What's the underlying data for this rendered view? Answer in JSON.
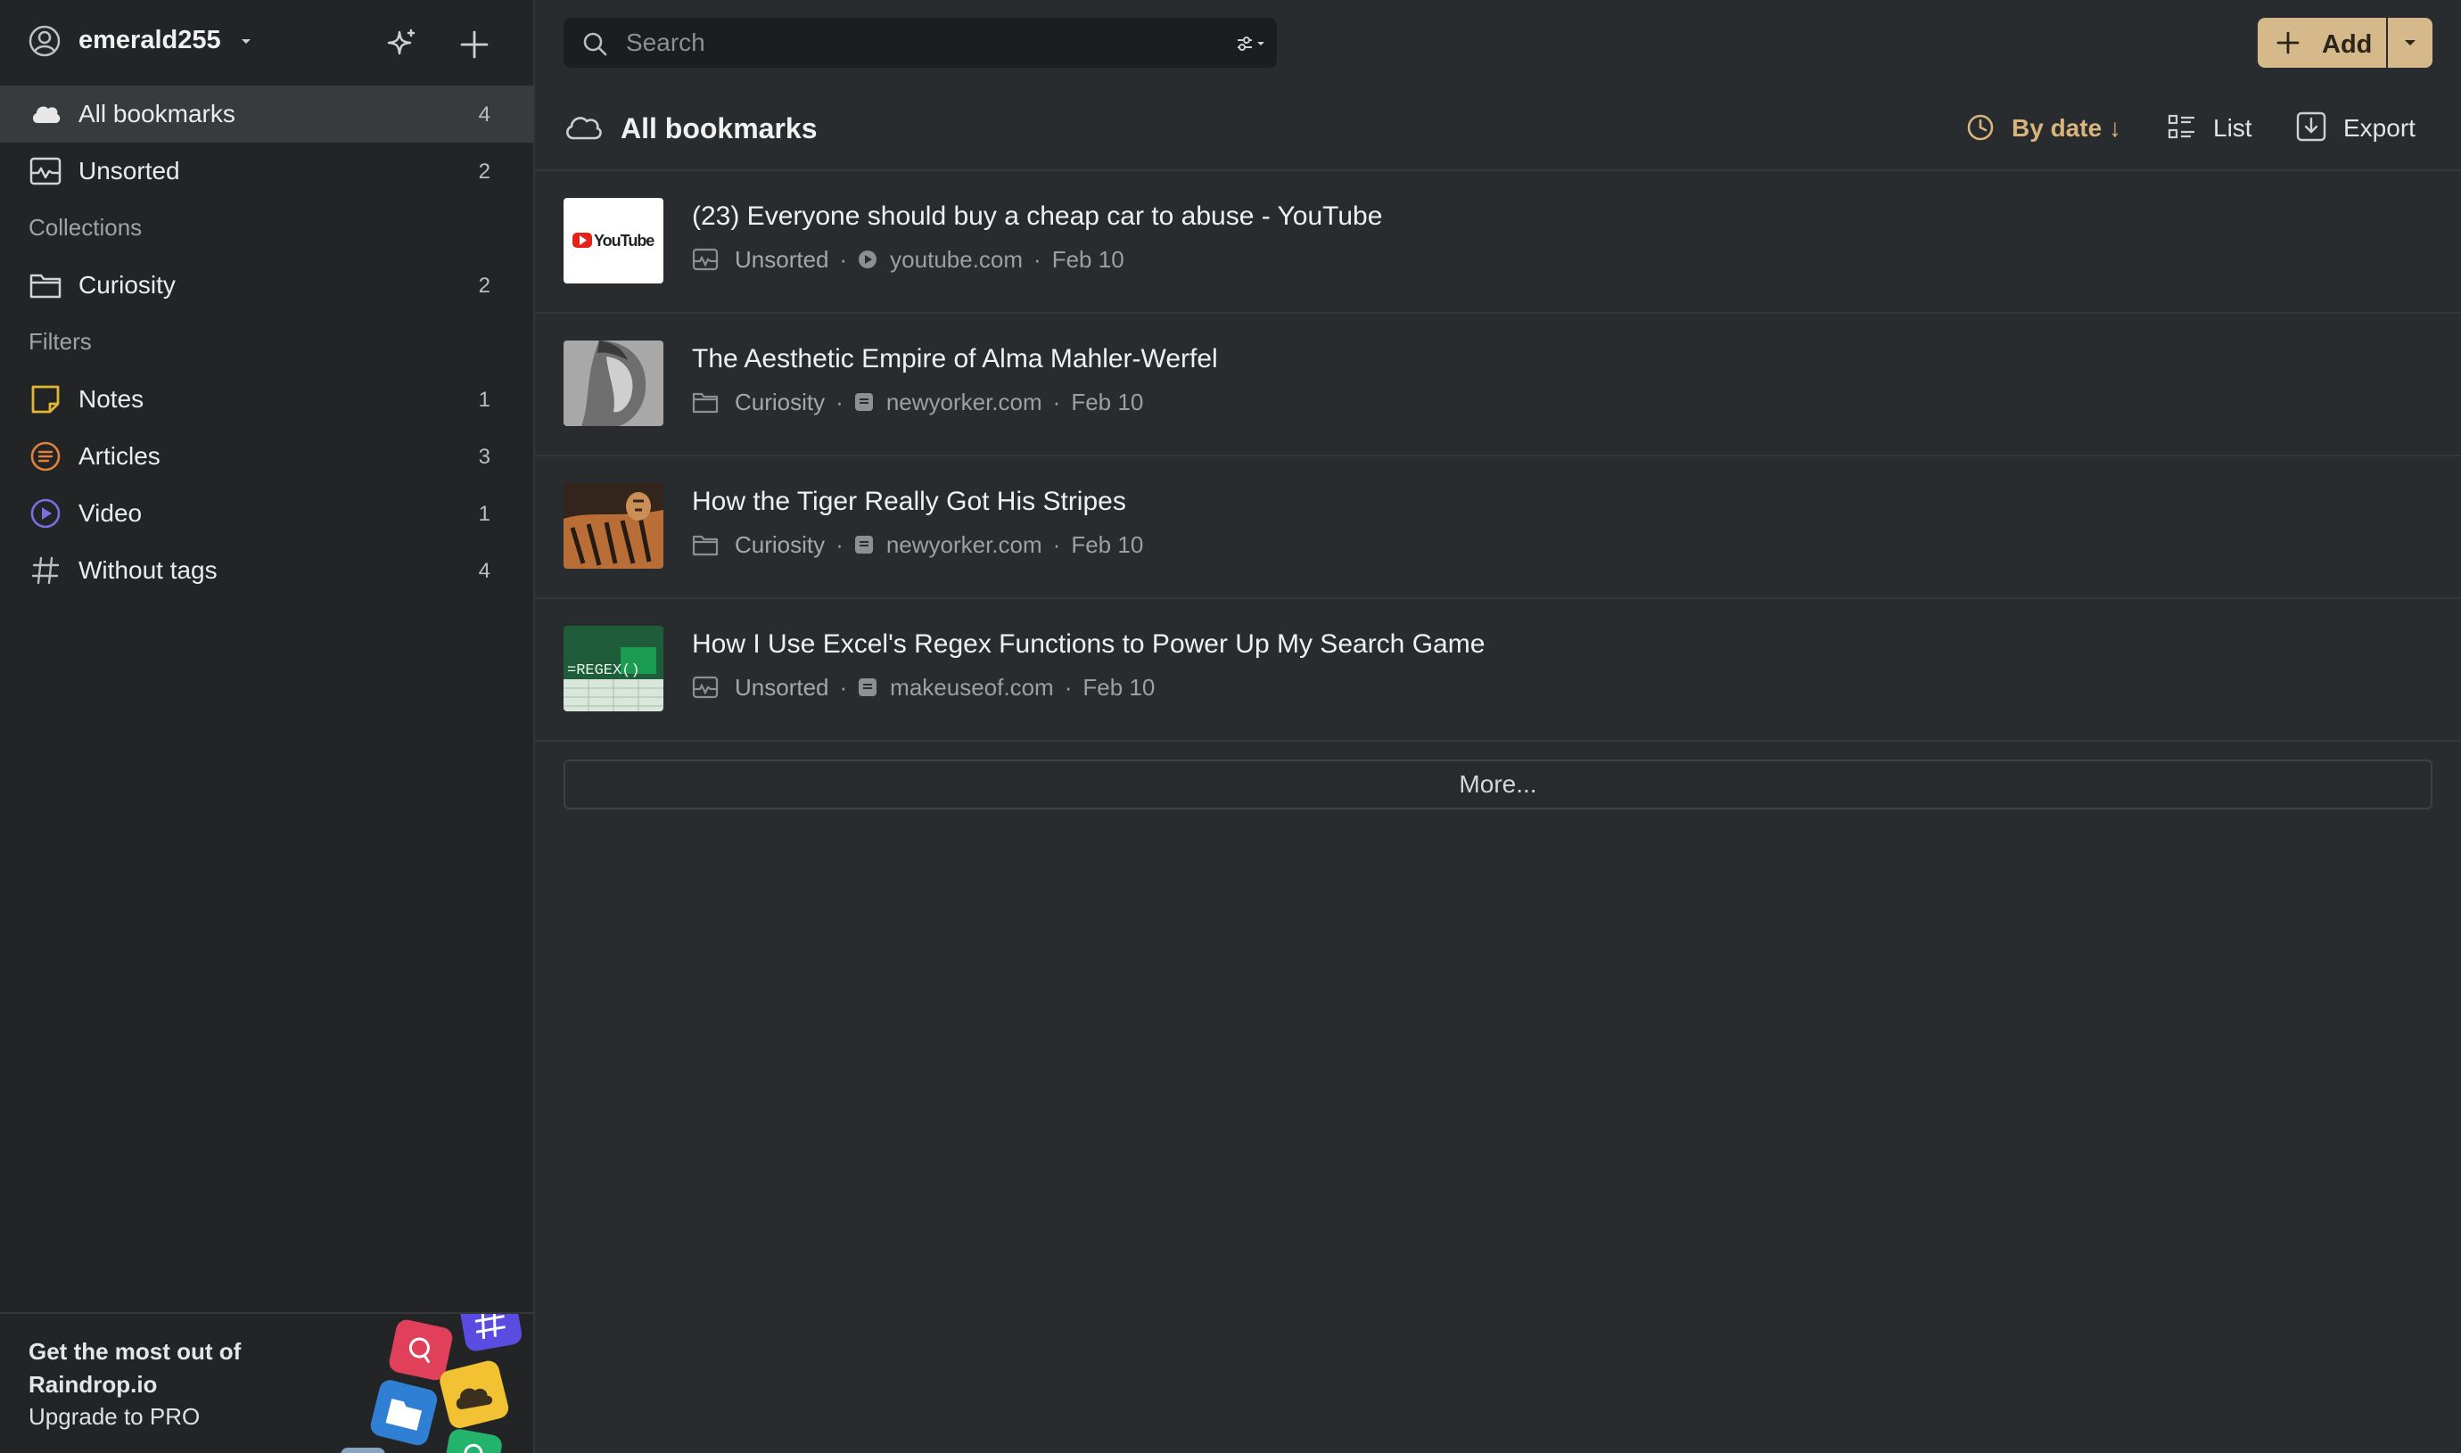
{
  "sidebar": {
    "user": {
      "name": "emerald255"
    },
    "top_items": [
      {
        "label": "All bookmarks",
        "count": "4",
        "icon": "cloud-icon"
      },
      {
        "label": "Unsorted",
        "count": "2",
        "icon": "inbox-icon"
      }
    ],
    "collections_heading": "Collections",
    "collections": [
      {
        "label": "Curiosity",
        "count": "2",
        "icon": "folder-icon"
      }
    ],
    "filters_heading": "Filters",
    "filters": [
      {
        "label": "Notes",
        "count": "1",
        "icon": "note-icon",
        "color": "#e2b634"
      },
      {
        "label": "Articles",
        "count": "3",
        "icon": "article-icon",
        "color": "#e0803a"
      },
      {
        "label": "Video",
        "count": "1",
        "icon": "play-icon",
        "color": "#7b6fe0"
      },
      {
        "label": "Without tags",
        "count": "4",
        "icon": "hash-icon"
      }
    ],
    "promo": {
      "title": "Get the most out of Raindrop.io",
      "subtitle": "Upgrade to PRO"
    }
  },
  "toolbar": {
    "search_placeholder": "Search",
    "add_label": "Add",
    "accent_color": "#d6b98a"
  },
  "header": {
    "title": "All bookmarks",
    "sort_label": "By date ↓",
    "view_label": "List",
    "export_label": "Export"
  },
  "bookmarks": [
    {
      "title": "(23) Everyone should buy a cheap car to abuse - YouTube",
      "collection": "Unsorted",
      "domain": "youtube.com",
      "date": "Feb 10",
      "thumb_text": "YouTube"
    },
    {
      "title": "The Aesthetic Empire of Alma Mahler-Werfel",
      "collection": "Curiosity",
      "domain": "newyorker.com",
      "date": "Feb 10"
    },
    {
      "title": "How the Tiger Really Got His Stripes",
      "collection": "Curiosity",
      "domain": "newyorker.com",
      "date": "Feb 10"
    },
    {
      "title": "How I Use Excel's Regex Functions to Power Up My Search Game",
      "collection": "Unsorted",
      "domain": "makeuseof.com",
      "date": "Feb 10",
      "thumb_text": "=REGEX()"
    }
  ],
  "more_label": "More..."
}
